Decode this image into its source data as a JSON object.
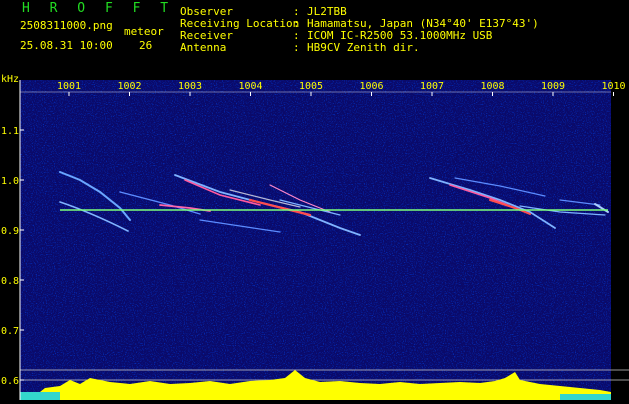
{
  "header": {
    "app_title": "H R O F F T",
    "filename": "2508311000.png",
    "timestamp": "25.08.31 10:00",
    "meteor_label": "meteor",
    "meteor_count": "26",
    "info": [
      {
        "label": "Observer",
        "sep": ":",
        "value": "JL2TBB"
      },
      {
        "label": "Receiving Location",
        "sep": ":",
        "value": "Hamamatsu, Japan (N34°40' E137°43')"
      },
      {
        "label": "Receiver",
        "sep": ":",
        "value": "ICOM IC-R2500 53.1000MHz USB"
      },
      {
        "label": "Antenna",
        "sep": ":",
        "value": "HB9CV Zenith dir."
      }
    ]
  },
  "spectrogram": {
    "y_unit": "kHz",
    "y_ticks": [
      "1.1",
      "1.0",
      "0.9",
      "0.8",
      "0.7",
      "0.6"
    ],
    "x_ticks": [
      "1001",
      "1002",
      "1003",
      "1004",
      "1005",
      "1006",
      "1007",
      "1008",
      "1009",
      "1010"
    ],
    "background_color": "#0a0a6a",
    "carrier_color": "#7cff7c",
    "level_color": "#ffff00"
  }
}
